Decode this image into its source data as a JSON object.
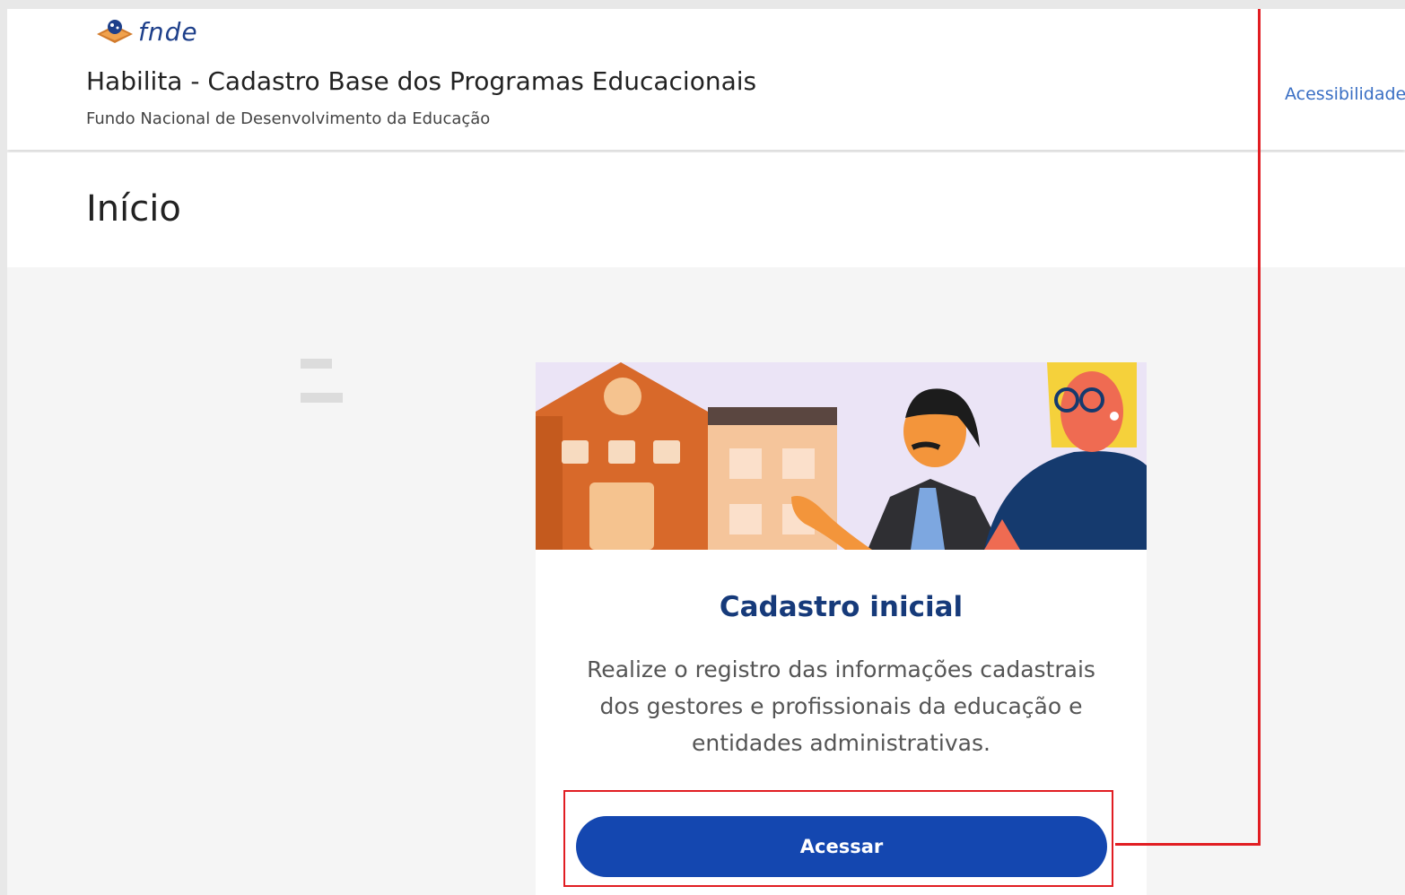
{
  "header": {
    "logo_text": "fnde",
    "app_title": "Habilita - Cadastro Base dos Programas Educacionais",
    "app_subtitle": "Fundo Nacional de Desenvolvimento da Educação",
    "accessibility_link": "Acessibilidade"
  },
  "page": {
    "title": "Início"
  },
  "card": {
    "title": "Cadastro inicial",
    "description": "Realize o registro das informações cadastrais dos gestores e profissionais da educação e entidades administrativas.",
    "button_label": "Acessar"
  },
  "colors": {
    "primary_button": "#1447b0",
    "title_blue": "#163a7a",
    "highlight_red": "#e11d22",
    "link_blue": "#3a6fc4"
  },
  "icons": {
    "logo": "fnde-logo-icon",
    "menu": "hamburger-menu-icon"
  }
}
